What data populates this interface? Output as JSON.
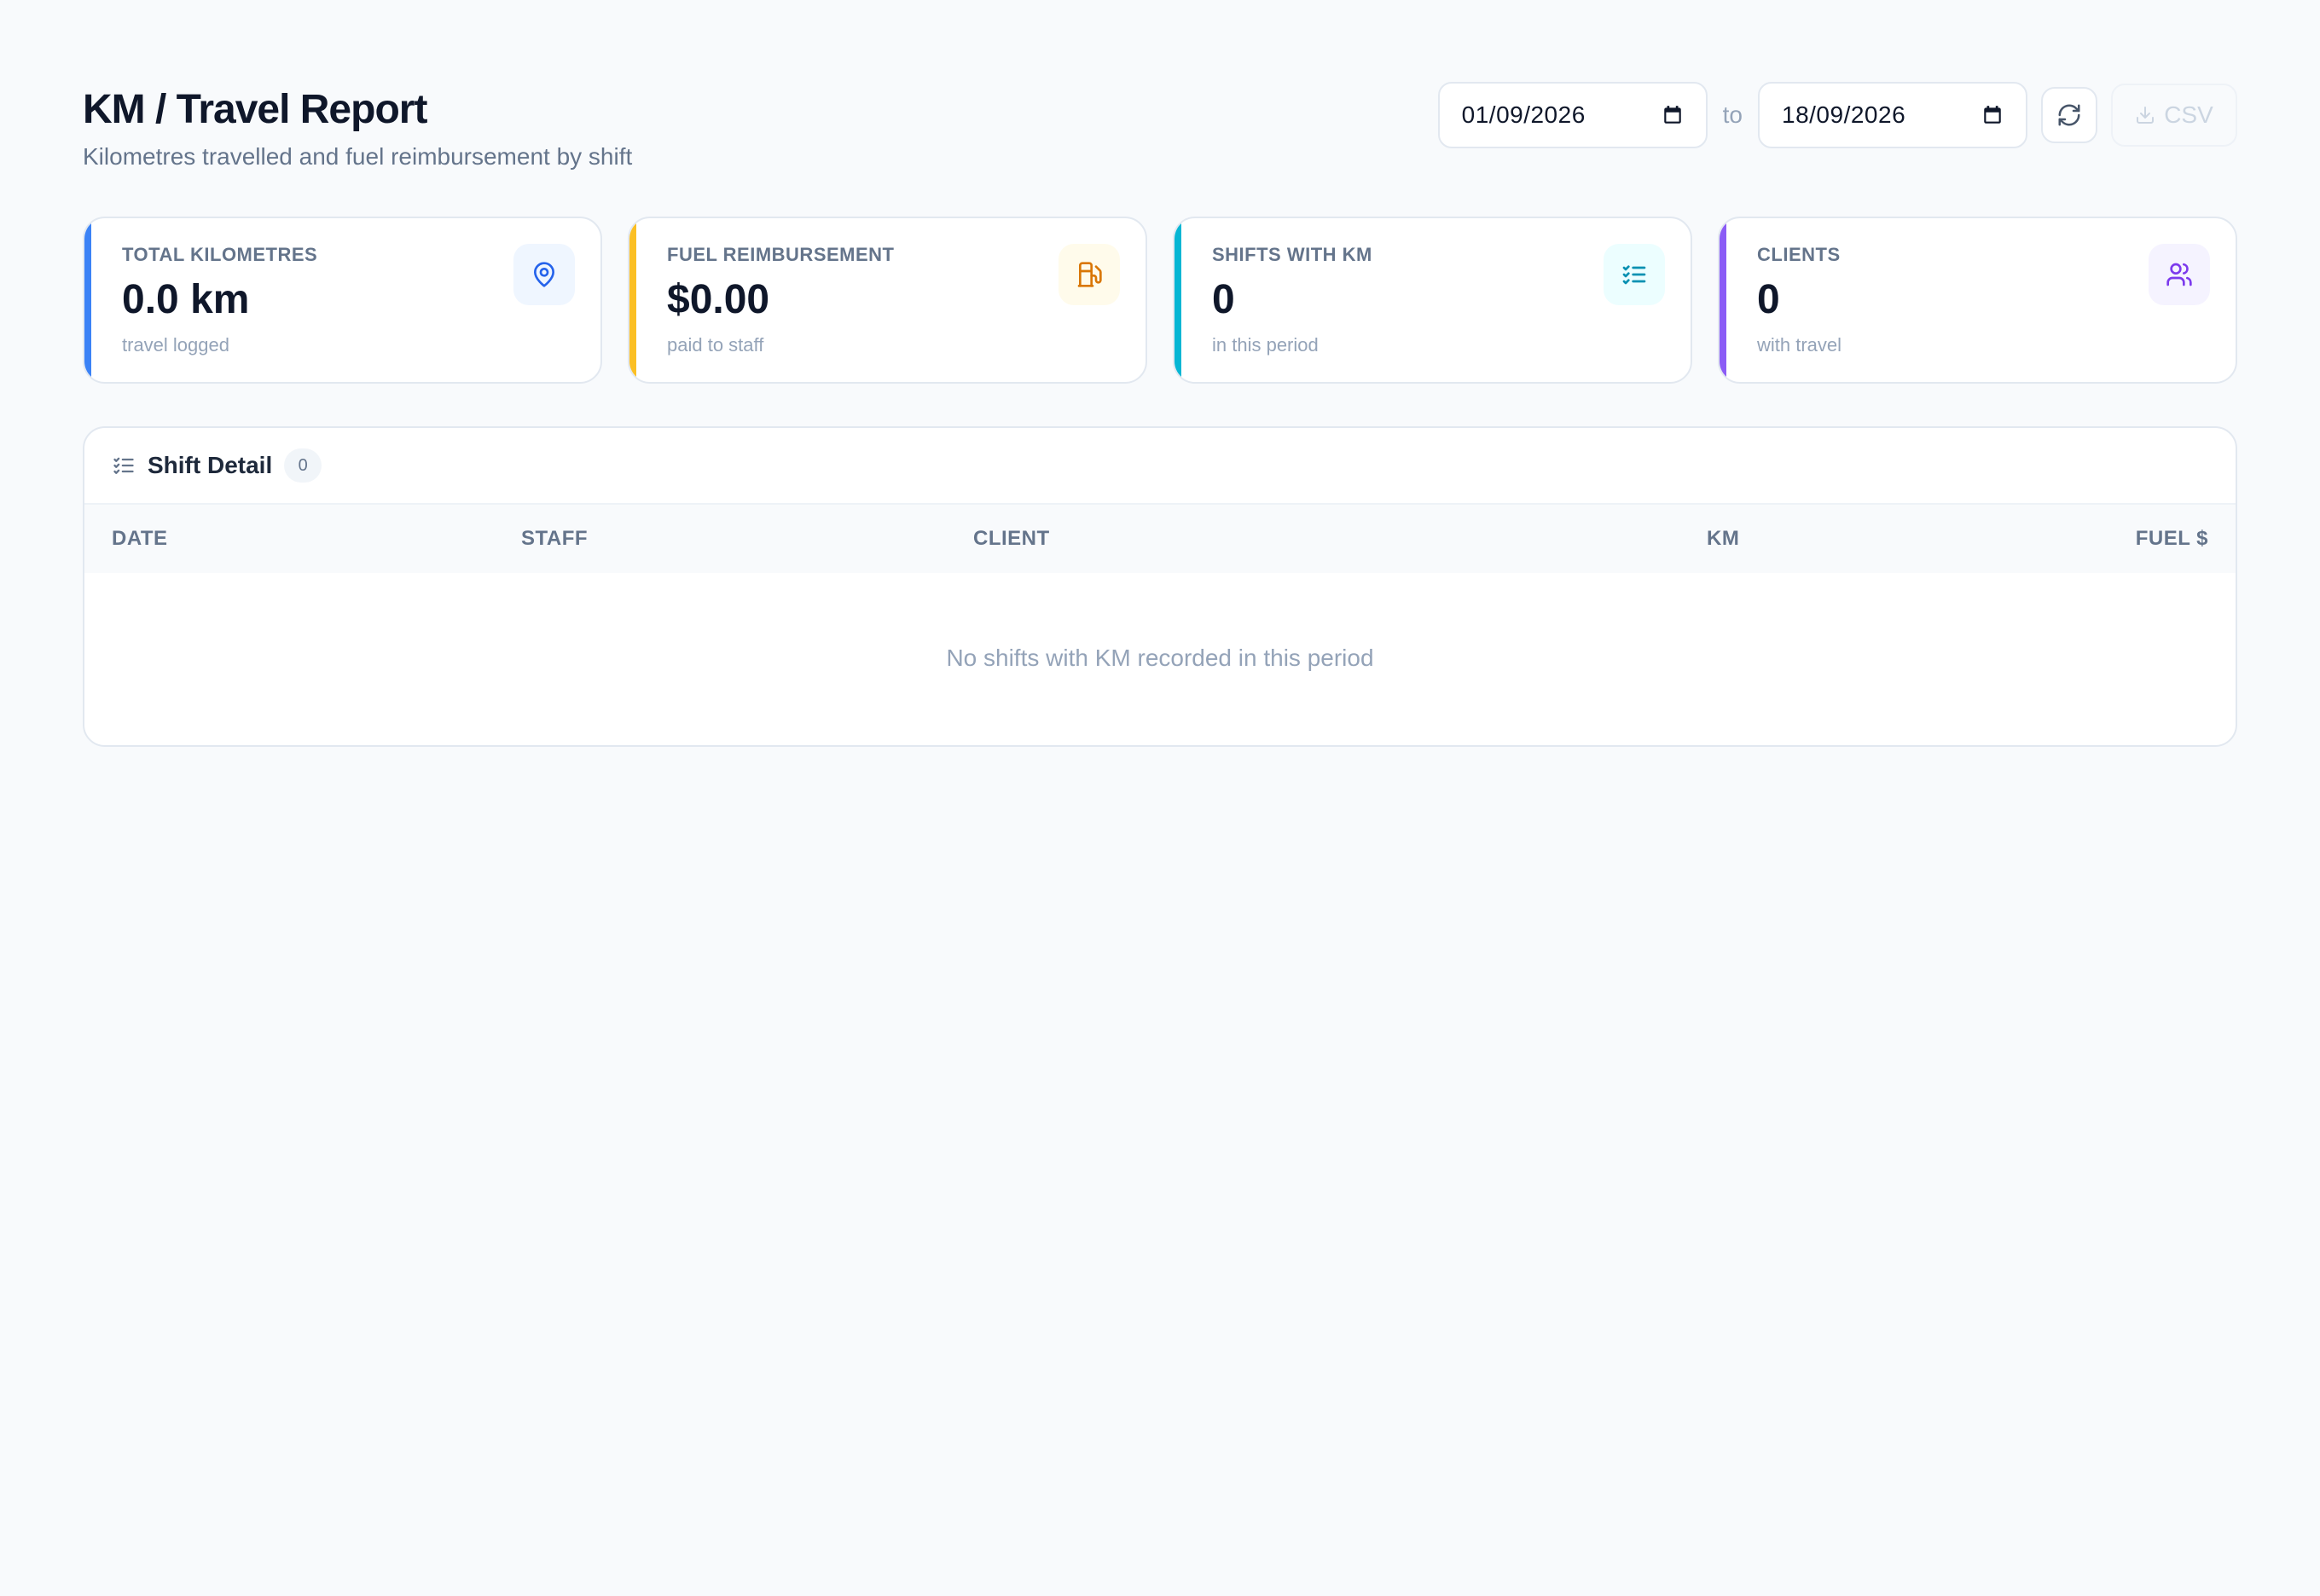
{
  "header": {
    "title": "KM / Travel Report",
    "subtitle": "Kilometres travelled and fuel reimbursement by shift"
  },
  "controls": {
    "from_date": "01/09/2026",
    "to_label": "to",
    "to_date": "18/09/2026",
    "refresh_icon": "refresh-icon",
    "csv_label": "CSV"
  },
  "stats": [
    {
      "label": "TOTAL KILOMETRES",
      "value": "0.0 km",
      "sub": "travel logged",
      "icon": "map-pin-icon",
      "accent": "#3b82f6",
      "icon_bg": "#eff6ff",
      "icon_color": "#2563eb"
    },
    {
      "label": "FUEL REIMBURSEMENT",
      "value": "$0.00",
      "sub": "paid to staff",
      "icon": "fuel-pump-icon",
      "accent": "#fbbf24",
      "icon_bg": "#fffbeb",
      "icon_color": "#d97706"
    },
    {
      "label": "SHIFTS WITH KM",
      "value": "0",
      "sub": "in this period",
      "icon": "list-checks-icon",
      "accent": "#06b6d4",
      "icon_bg": "#ecfeff",
      "icon_color": "#0891b2"
    },
    {
      "label": "CLIENTS",
      "value": "0",
      "sub": "with travel",
      "icon": "users-icon",
      "accent": "#8b5cf6",
      "icon_bg": "#f5f3ff",
      "icon_color": "#7c3aed"
    }
  ],
  "table": {
    "title": "Shift Detail",
    "count": "0",
    "columns": [
      "DATE",
      "STAFF",
      "CLIENT",
      "KM",
      "FUEL $"
    ],
    "empty_message": "No shifts with KM recorded in this period"
  }
}
